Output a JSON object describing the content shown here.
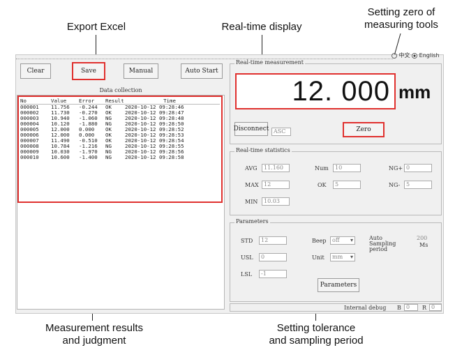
{
  "annotations": {
    "export_excel": "Export Excel",
    "realtime_display": "Real-time display",
    "setting_zero": "Setting zero of\nmeasuring tools",
    "measurement_results": "Measurement results\nand judgment",
    "setting_tolerance": "Setting tolerance\nand sampling period"
  },
  "language": {
    "chinese": "中文",
    "english": "English",
    "selected": "English"
  },
  "toolbar": {
    "clear": "Clear",
    "save": "Save",
    "manual": "Manual",
    "auto_start": "Auto Start"
  },
  "data_collection": {
    "title": "Data collection",
    "columns": [
      "No",
      "Value",
      "Error",
      "Result",
      "Time"
    ],
    "rows": [
      [
        "000001",
        "11.756",
        "-0.244",
        "OK",
        "2020-10-12  09:28:46"
      ],
      [
        "000002",
        "11.730",
        "-0.270",
        "OK",
        "2020-10-12  09:28:47"
      ],
      [
        "000003",
        "10.940",
        "-1.060",
        "NG",
        "2020-10-12  09:28:48"
      ],
      [
        "000004",
        "10.120",
        "-1.880",
        "NG",
        "2020-10-12  09:28:50"
      ],
      [
        "000005",
        "12.000",
        "0.000",
        "OK",
        "2020-10-12  09:28:52"
      ],
      [
        "000006",
        "12.000",
        "0.000",
        "OK",
        "2020-10-12  09:28:53"
      ],
      [
        "000007",
        "11.490",
        "-0.510",
        "OK",
        "2020-10-12  09:28:54"
      ],
      [
        "000008",
        "10.784",
        "-1.216",
        "NG",
        "2020-10-12  09:28:55"
      ],
      [
        "000009",
        "10.030",
        "-1.970",
        "NG",
        "2020-10-12  09:28:56"
      ],
      [
        "000010",
        "10.600",
        "-1.400",
        "NG",
        "2020-10-12  09:28:58"
      ]
    ]
  },
  "realtime": {
    "group_title": "Real-time measurement",
    "value": "12. 000",
    "unit": "mm",
    "disconnect": "Disconnect",
    "status": "ASC",
    "zero": "Zero"
  },
  "statistics": {
    "group_title": "Real-time statistics",
    "avg_label": "AVG",
    "avg_value": "11.160",
    "num_label": "Num",
    "num_value": "10",
    "ng_plus_label": "NG+",
    "ng_plus_value": "0",
    "max_label": "MAX",
    "max_value": "12",
    "ok_label": "OK",
    "ok_value": "5",
    "ng_minus_label": "NG-",
    "ng_minus_value": "5",
    "min_label": "MIN",
    "min_value": "10.03"
  },
  "parameters": {
    "group_title": "Parameters",
    "std_label": "STD",
    "std_value": "12",
    "beep_label": "Beep",
    "beep_value": "off",
    "auto_label": "Auto",
    "sampling_label": "Sampling",
    "period_label": "period",
    "auto_value": "200",
    "ms_label": "Ms",
    "usl_label": "USL",
    "usl_value": "0",
    "unit_label": "Unit",
    "unit_value": "mm",
    "lsl_label": "LSL",
    "lsl_value": "-1",
    "button": "Parameters"
  },
  "debug": {
    "label": "Internal debug",
    "b_label": "B",
    "b_value": "0",
    "r_label": "R",
    "r_value": "0"
  }
}
